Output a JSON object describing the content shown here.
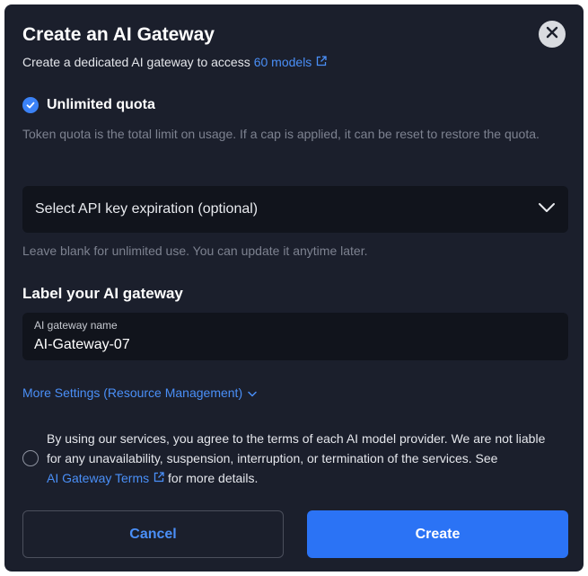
{
  "dialog": {
    "title": "Create an AI Gateway",
    "subtitle_prefix": "Create a dedicated AI gateway to access",
    "models_link": "60 models"
  },
  "quota": {
    "checked": true,
    "label": "Unlimited quota",
    "description": "Token quota is the total limit on usage. If a cap is applied, it can be reset to restore the quota."
  },
  "expiration": {
    "selected_text": "Select API key expiration (optional)",
    "hint": "Leave blank for unlimited use. You can update it anytime later."
  },
  "label_section": {
    "heading": "Label your AI gateway",
    "field_label": "AI gateway name",
    "field_value": "AI-Gateway-07"
  },
  "more_settings": {
    "label": "More Settings (Resource Management)"
  },
  "terms": {
    "checked": false,
    "text_before": "By using our services, you agree to the terms of each AI model provider. We are not liable for any unavailability, suspension, interruption, or termination of the services. See",
    "link": "AI Gateway Terms",
    "text_after": "for more details."
  },
  "buttons": {
    "cancel": "Cancel",
    "create": "Create"
  },
  "colors": {
    "background": "#1b1f2c",
    "accent": "#2b73f5",
    "link": "#4a8ff7",
    "muted_text": "#7d8290"
  }
}
